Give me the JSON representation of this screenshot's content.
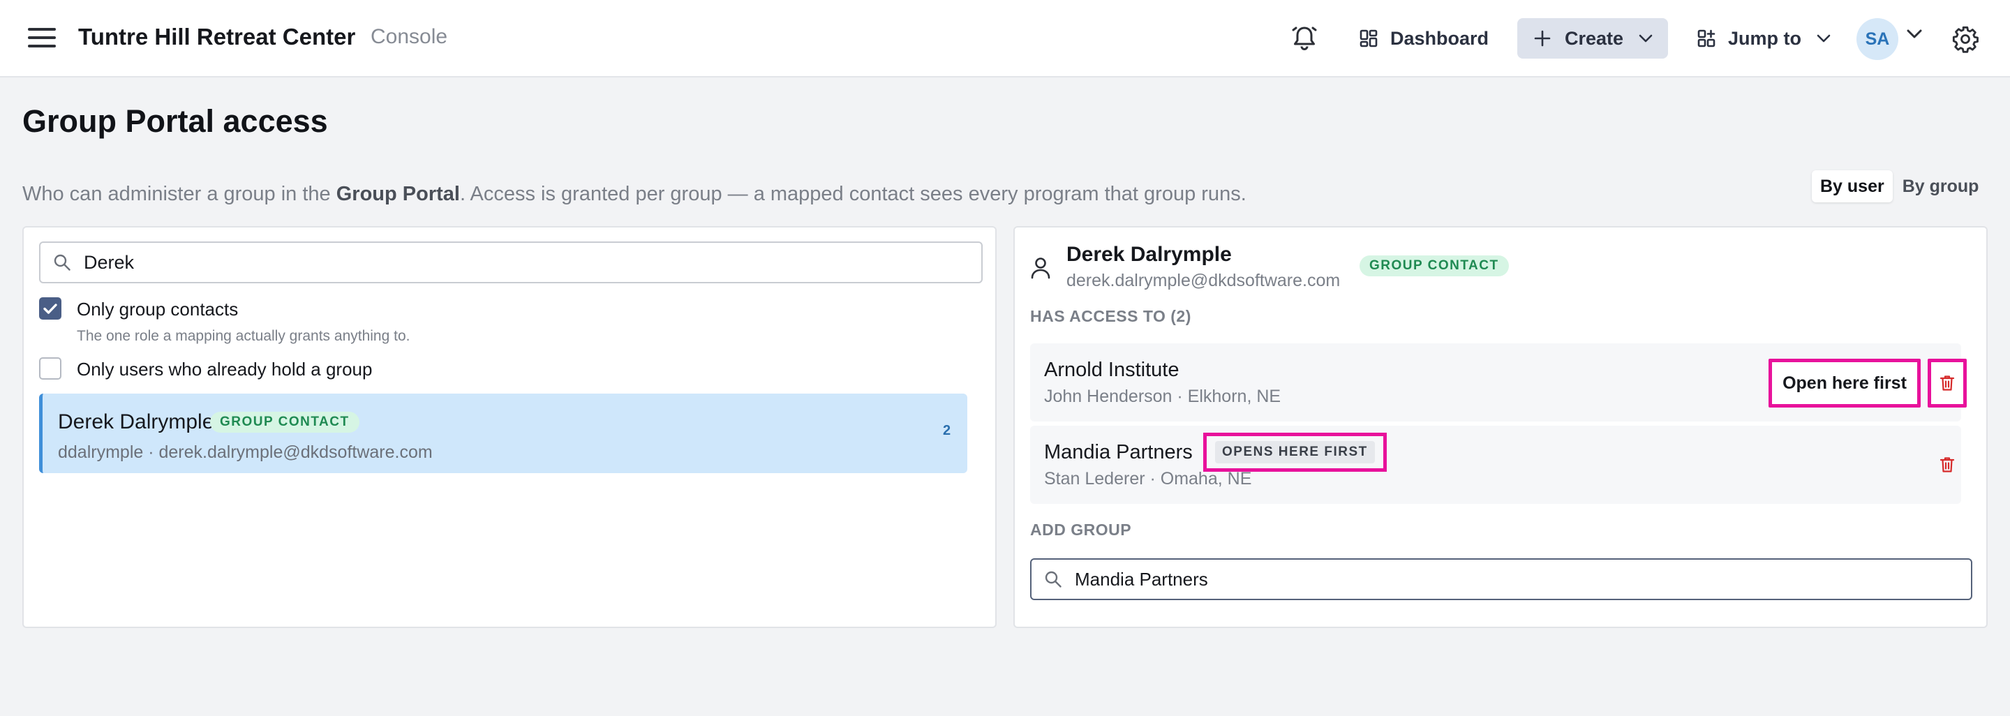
{
  "header": {
    "app_title": "Tuntre Hill Retreat Center",
    "app_subtitle": "Console",
    "nav": {
      "dashboard": "Dashboard",
      "create": "Create",
      "jump_to": "Jump to"
    },
    "avatar_initials": "SA"
  },
  "page": {
    "title": "Group Portal access",
    "description_prefix": "Who can administer a group in the ",
    "description_bold": "Group Portal",
    "description_suffix": ". Access is granted per group — a mapped contact sees every program that group runs.",
    "view_toggle": {
      "by_user": "By user",
      "by_group": "By group",
      "selected": "by_user"
    }
  },
  "left": {
    "search_value": "Derek",
    "filters": [
      {
        "label": "Only group contacts",
        "hint": "The one role a mapping actually grants anything to.",
        "checked": true
      },
      {
        "label": "Only users who already hold a group",
        "hint": "",
        "checked": false
      }
    ],
    "results": [
      {
        "name": "Derek Dalrymple",
        "badge": "GROUP CONTACT",
        "meta": "ddalrymple · derek.dalrymple@dkdsoftware.com",
        "count": "2"
      }
    ]
  },
  "right": {
    "user": {
      "name": "Derek Dalrymple",
      "email": "derek.dalrymple@dkdsoftware.com",
      "badge": "GROUP CONTACT"
    },
    "access_heading": "HAS ACCESS TO (2)",
    "access": [
      {
        "name": "Arnold Institute",
        "meta": "John Henderson · Elkhorn, NE",
        "action": "Open here first"
      },
      {
        "name": "Mandia Partners",
        "meta": "Stan Lederer · Omaha, NE",
        "tag": "OPENS HERE FIRST"
      }
    ],
    "add_heading": "ADD GROUP",
    "add_search_value": "Mandia Partners"
  },
  "colors": {
    "accent_blue": "#3f8fd9",
    "selected_row": "#cfe7fb",
    "badge_green": "#1f8a52",
    "danger_red": "#d62b2b",
    "highlight_magenta": "#e8119b"
  }
}
